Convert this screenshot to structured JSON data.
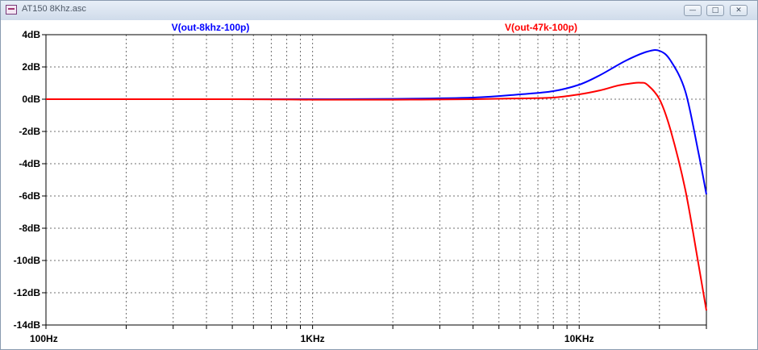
{
  "window": {
    "title": "AT150 8Khz.asc",
    "buttons": {
      "minimize": "—",
      "maximize": "□",
      "close": "✕"
    },
    "icon": "schematic-icon"
  },
  "chart_data": {
    "type": "line",
    "x_scale": "log",
    "xlim": [
      100,
      30000
    ],
    "ylim": [
      -14,
      4
    ],
    "x_ticks": [
      {
        "v": 100,
        "label": "100Hz"
      },
      {
        "v": 1000,
        "label": "1KHz"
      },
      {
        "v": 10000,
        "label": "10KHz"
      }
    ],
    "y_ticks": [
      {
        "v": 4,
        "label": "4dB"
      },
      {
        "v": 2,
        "label": "2dB"
      },
      {
        "v": 0,
        "label": "0dB"
      },
      {
        "v": -2,
        "label": "-2dB"
      },
      {
        "v": -4,
        "label": "-4dB"
      },
      {
        "v": -6,
        "label": "-6dB"
      },
      {
        "v": -8,
        "label": "-8dB"
      },
      {
        "v": -10,
        "label": "-10dB"
      },
      {
        "v": -12,
        "label": "-12dB"
      },
      {
        "v": -14,
        "label": "-14dB"
      }
    ],
    "grid": true,
    "series": [
      {
        "name": "V(out-8khz-100p)",
        "color": "#0000ff",
        "x": [
          100,
          500,
          1000,
          2000,
          4000,
          6000,
          8000,
          10000,
          12000,
          15000,
          18000,
          20000,
          22000,
          25000,
          28000,
          30000
        ],
        "y": [
          0,
          0,
          0,
          0.02,
          0.1,
          0.3,
          0.5,
          0.9,
          1.5,
          2.4,
          2.95,
          3.0,
          2.4,
          0.5,
          -3.3,
          -5.9
        ]
      },
      {
        "name": "V(out-47k-100p)",
        "color": "#ff0000",
        "x": [
          100,
          500,
          1000,
          2000,
          4000,
          6000,
          8000,
          10000,
          12000,
          14000,
          16000,
          17000,
          18000,
          20000,
          22000,
          25000,
          28000,
          30000
        ],
        "y": [
          0,
          0,
          -0.03,
          -0.03,
          0,
          0.05,
          0.1,
          0.3,
          0.55,
          0.85,
          1.0,
          1.02,
          0.9,
          0,
          -1.9,
          -5.6,
          -10.2,
          -13.1
        ]
      }
    ]
  }
}
